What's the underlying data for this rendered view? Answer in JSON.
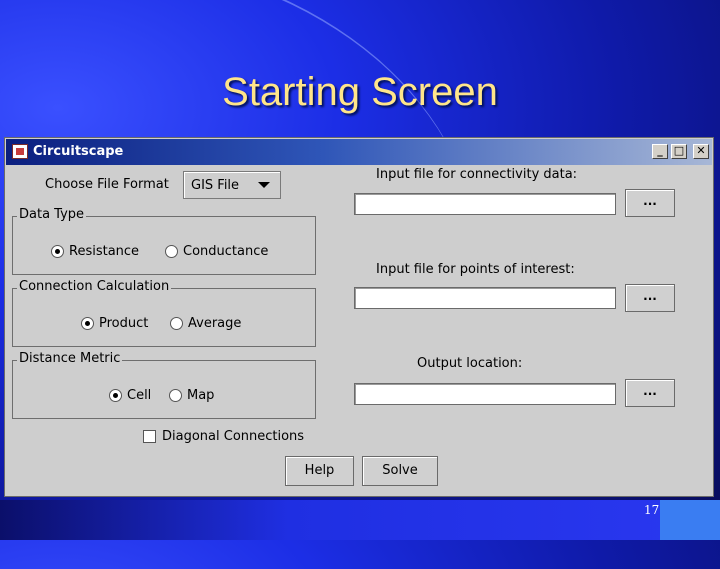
{
  "slide": {
    "title": "Starting Screen",
    "page_number": "17"
  },
  "window": {
    "title": "Circuitscape",
    "controls": [
      "_",
      "□",
      "✕"
    ]
  },
  "file_format": {
    "label": "Choose File Format",
    "selected": "GIS File"
  },
  "groups": {
    "data_type": {
      "title": "Data Type",
      "options": [
        "Resistance",
        "Conductance"
      ],
      "selected": "Resistance"
    },
    "connection_calculation": {
      "title": "Connection Calculation",
      "options": [
        "Product",
        "Average"
      ],
      "selected": "Product"
    },
    "distance_metric": {
      "title": "Distance Metric",
      "options": [
        "Cell",
        "Map"
      ],
      "selected": "Cell"
    }
  },
  "diagonal": {
    "label": "Diagonal Connections",
    "checked": false
  },
  "inputs": {
    "connectivity": {
      "label": "Input file for connectivity data:",
      "value": "",
      "browse": "..."
    },
    "points": {
      "label": "Input file for points of interest:",
      "value": "",
      "browse": "..."
    },
    "output": {
      "label": "Output location:",
      "value": "",
      "browse": "..."
    }
  },
  "buttons": {
    "help": "Help",
    "solve": "Solve"
  }
}
